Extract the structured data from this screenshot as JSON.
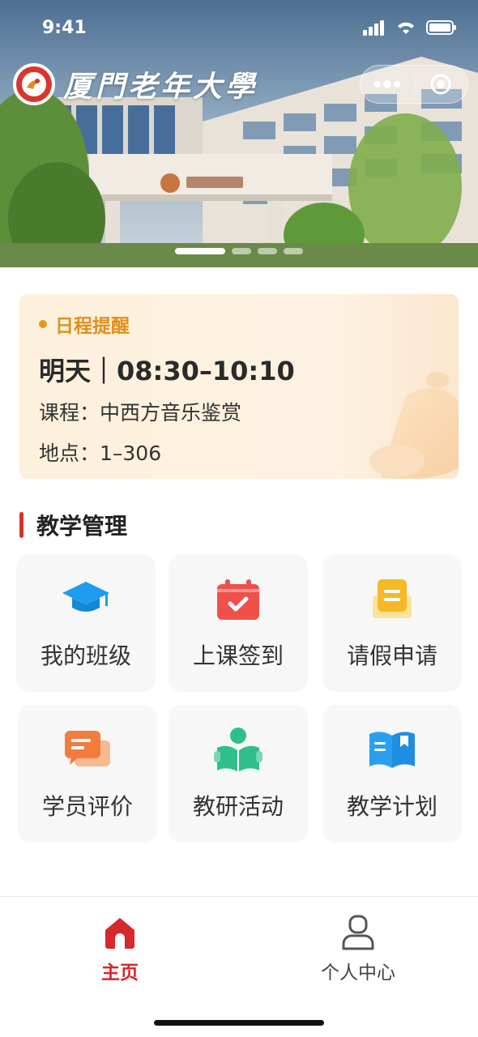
{
  "status_bar": {
    "time": "9:41"
  },
  "hero": {
    "brand_name": "厦門老年大學",
    "carousel": {
      "count": 4,
      "active_index": 0
    }
  },
  "schedule": {
    "tag": "日程提醒",
    "time": "明天｜08:30–10:10",
    "course": "课程：中西方音乐鉴赏",
    "place": "地点：1–306"
  },
  "section": {
    "title": "教学管理"
  },
  "tiles": [
    {
      "label": "我的班级",
      "icon": "graduation-cap-icon",
      "color": "#1e9cf0"
    },
    {
      "label": "上课签到",
      "icon": "calendar-check-icon",
      "color": "#f0504a"
    },
    {
      "label": "请假申请",
      "icon": "leave-note-icon",
      "color": "#f6b825"
    },
    {
      "label": "学员评价",
      "icon": "chat-bubble-icon",
      "color": "#f27c3e"
    },
    {
      "label": "教研活动",
      "icon": "reading-person-icon",
      "color": "#2fbf8a"
    },
    {
      "label": "教学计划",
      "icon": "open-book-icon",
      "color": "#2a9ff0"
    }
  ],
  "tabbar": {
    "home": {
      "label": "主页",
      "icon": "home-icon",
      "active": true,
      "color": "#d6282d"
    },
    "me": {
      "label": "个人中心",
      "icon": "user-icon",
      "active": false
    }
  }
}
